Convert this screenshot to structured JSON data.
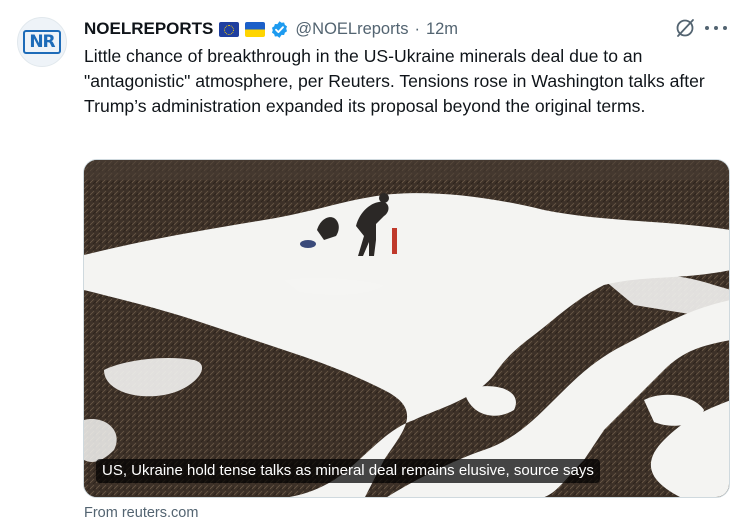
{
  "tweet": {
    "author_name": "NOELREPORTS",
    "author_handle": "@NOELreports",
    "separator": "·",
    "time_ago": "12m",
    "avatar_initials": "NR",
    "text": "Little chance of breakthrough in the US-Ukraine minerals deal due to an \"antagonistic\" atmosphere, per Reuters. Tensions rose in Washington talks after Trump’s administration expanded its proposal beyond the original terms.",
    "card": {
      "caption": "US, Ukraine hold tense talks as mineral deal remains elusive, source says",
      "source": "From reuters.com"
    }
  },
  "icons": [
    "eu-flag-icon",
    "ukraine-flag-icon",
    "verified-badge-icon",
    "grok-icon",
    "more-icon"
  ],
  "colors": {
    "text": "#0f1419",
    "secondary_text": "#536471",
    "verified": "#1d9bf0",
    "border": "#cfd9de",
    "brand_blue": "#1d6bb8"
  }
}
